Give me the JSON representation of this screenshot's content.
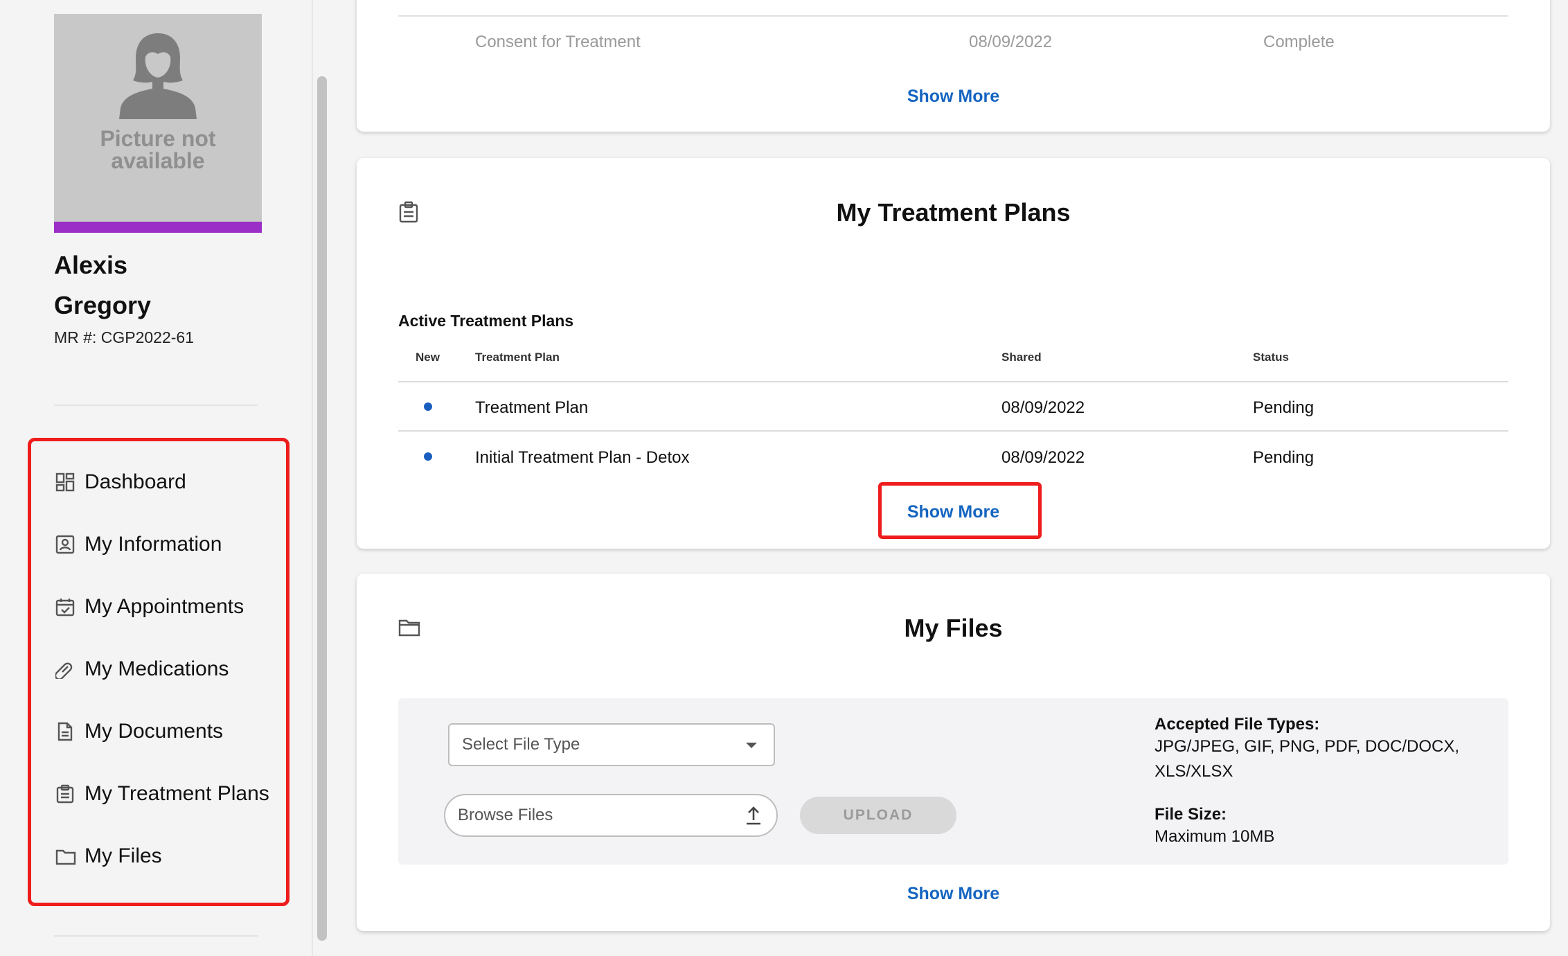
{
  "patient": {
    "photo_caption_line1": "Picture not",
    "photo_caption_line2": "available",
    "first_name": "Alexis",
    "last_name": "Gregory",
    "mr_number": "MR #: CGP2022-61"
  },
  "nav": {
    "items": [
      {
        "label": "Dashboard",
        "icon": "dashboard-icon"
      },
      {
        "label": "My Information",
        "icon": "id-card-icon"
      },
      {
        "label": "My Appointments",
        "icon": "calendar-check-icon"
      },
      {
        "label": "My Medications",
        "icon": "pill-icon"
      },
      {
        "label": "My Documents",
        "icon": "document-icon"
      },
      {
        "label": "My Treatment Plans",
        "icon": "clipboard-icon"
      },
      {
        "label": "My Files",
        "icon": "folder-icon"
      }
    ]
  },
  "documents_card": {
    "row": {
      "name": "Consent for Treatment",
      "date": "08/09/2022",
      "status": "Complete"
    },
    "show_more": "Show More"
  },
  "treatment_card": {
    "title": "My Treatment Plans",
    "subtitle": "Active Treatment Plans",
    "columns": {
      "new": "New",
      "plan": "Treatment Plan",
      "shared": "Shared",
      "status": "Status"
    },
    "rows": [
      {
        "plan": "Treatment Plan",
        "shared": "08/09/2022",
        "status": "Pending"
      },
      {
        "plan": "Initial Treatment Plan - Detox",
        "shared": "08/09/2022",
        "status": "Pending"
      }
    ],
    "show_more": "Show More"
  },
  "files_card": {
    "title": "My Files",
    "select_placeholder": "Select File Type",
    "browse_placeholder": "Browse Files",
    "upload_label": "UPLOAD",
    "accepted_heading": "Accepted File Types:",
    "accepted_types": "JPG/JPEG, GIF, PNG, PDF, DOC/DOCX, XLS/XLSX",
    "size_heading": "File Size:",
    "size_value": "Maximum 10MB",
    "show_more": "Show More"
  },
  "colors": {
    "accent_link": "#1565c0",
    "avatar_bar": "#9a2ec7",
    "highlight": "#ee1c1c",
    "new_dot": "#1a5fbf"
  }
}
